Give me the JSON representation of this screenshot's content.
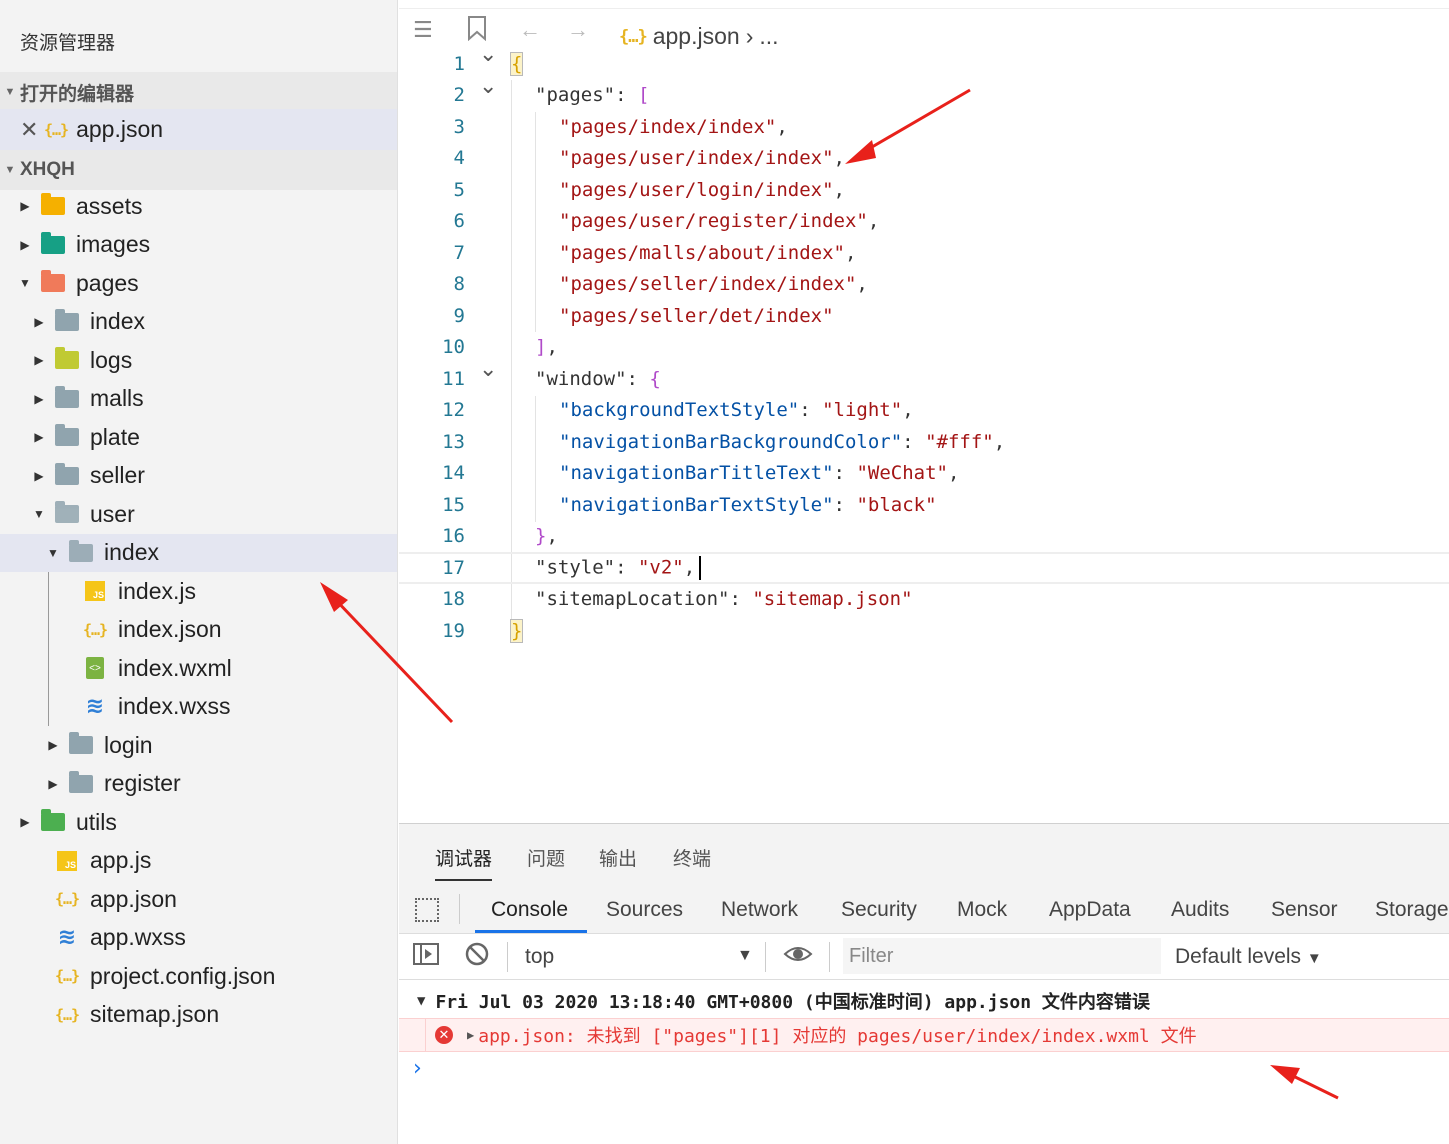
{
  "sidebar": {
    "title": "资源管理器",
    "open_editors_label": "打开的编辑器",
    "open_file": "app.json",
    "project_label": "XHQH",
    "tree": [
      {
        "label": "assets",
        "type": "folder",
        "color": "#f5b000",
        "depth": 0,
        "arrow": "right"
      },
      {
        "label": "images",
        "type": "folder",
        "color": "#16a085",
        "depth": 0,
        "arrow": "right"
      },
      {
        "label": "pages",
        "type": "folder",
        "color": "#f07a5a",
        "depth": 0,
        "arrow": "down"
      },
      {
        "label": "index",
        "type": "folder",
        "color": "#90a4ae",
        "depth": 1,
        "arrow": "right"
      },
      {
        "label": "logs",
        "type": "folder",
        "color": "#c0ca33",
        "depth": 1,
        "arrow": "right"
      },
      {
        "label": "malls",
        "type": "folder",
        "color": "#90a4ae",
        "depth": 1,
        "arrow": "right"
      },
      {
        "label": "plate",
        "type": "folder",
        "color": "#90a4ae",
        "depth": 1,
        "arrow": "right"
      },
      {
        "label": "seller",
        "type": "folder",
        "color": "#90a4ae",
        "depth": 1,
        "arrow": "right"
      },
      {
        "label": "user",
        "type": "folder-open",
        "color": "#90a4ae",
        "depth": 1,
        "arrow": "down"
      },
      {
        "label": "index",
        "type": "folder-open",
        "color": "#90a4ae",
        "depth": 2,
        "arrow": "down",
        "selected": true
      },
      {
        "label": "index.js",
        "type": "js",
        "depth": 3
      },
      {
        "label": "index.json",
        "type": "json",
        "depth": 3
      },
      {
        "label": "index.wxml",
        "type": "wxml",
        "depth": 3
      },
      {
        "label": "index.wxss",
        "type": "css",
        "depth": 3
      },
      {
        "label": "login",
        "type": "folder",
        "color": "#90a4ae",
        "depth": 2,
        "arrow": "right"
      },
      {
        "label": "register",
        "type": "folder",
        "color": "#90a4ae",
        "depth": 2,
        "arrow": "right"
      },
      {
        "label": "utils",
        "type": "folder",
        "color": "#4caf50",
        "depth": 0,
        "arrow": "right"
      },
      {
        "label": "app.js",
        "type": "js",
        "depth": 1
      },
      {
        "label": "app.json",
        "type": "json",
        "depth": 1
      },
      {
        "label": "app.wxss",
        "type": "css",
        "depth": 1
      },
      {
        "label": "project.config.json",
        "type": "json",
        "depth": 1
      },
      {
        "label": "sitemap.json",
        "type": "json",
        "depth": 1
      }
    ]
  },
  "editor": {
    "breadcrumb_file": "app.json",
    "breadcrumb_more": "...",
    "lines": [
      {
        "n": "1",
        "fold": true
      },
      {
        "n": "2",
        "fold": true
      },
      {
        "n": "3"
      },
      {
        "n": "4"
      },
      {
        "n": "5"
      },
      {
        "n": "6"
      },
      {
        "n": "7"
      },
      {
        "n": "8"
      },
      {
        "n": "9"
      },
      {
        "n": "10"
      },
      {
        "n": "11",
        "fold": true
      },
      {
        "n": "12"
      },
      {
        "n": "13"
      },
      {
        "n": "14"
      },
      {
        "n": "15"
      },
      {
        "n": "16"
      },
      {
        "n": "17"
      },
      {
        "n": "18"
      },
      {
        "n": "19"
      }
    ],
    "code": {
      "l2_key": "\"pages\"",
      "pages": [
        "\"pages/index/index\"",
        "\"pages/user/index/index\"",
        "\"pages/user/login/index\"",
        "\"pages/user/register/index\"",
        "\"pages/malls/about/index\"",
        "\"pages/seller/index/index\"",
        "\"pages/seller/det/index\""
      ],
      "l11_key": "\"window\"",
      "window": [
        {
          "k": "\"backgroundTextStyle\"",
          "v": "\"light\"",
          "comma": ","
        },
        {
          "k": "\"navigationBarBackgroundColor\"",
          "v": "\"#fff\"",
          "comma": ","
        },
        {
          "k": "\"navigationBarTitleText\"",
          "v": "\"WeChat\"",
          "comma": ","
        },
        {
          "k": "\"navigationBarTextStyle\"",
          "v": "\"black\"",
          "comma": ""
        }
      ],
      "l17_key": "\"style\"",
      "l17_val": "\"v2\"",
      "l18_key": "\"sitemapLocation\"",
      "l18_val": "\"sitemap.json\""
    }
  },
  "panel": {
    "tabs": [
      "调试器",
      "问题",
      "输出",
      "终端"
    ],
    "devtools_tabs": [
      "Console",
      "Sources",
      "Network",
      "Security",
      "Mock",
      "AppData",
      "Audits",
      "Sensor",
      "Storage"
    ],
    "context": "top",
    "filter_placeholder": "Filter",
    "levels": "Default levels",
    "group_message": "Fri Jul 03 2020 13:18:40 GMT+0800 (中国标准时间)  app.json 文件内容错误",
    "error_message": "app.json: 未找到 [\"pages\"][1] 对应的 pages/user/index/index.wxml 文件"
  },
  "colors": {
    "annotation_arrow": "#e8211b",
    "error": "#e53935",
    "accent": "#1a73e8"
  }
}
